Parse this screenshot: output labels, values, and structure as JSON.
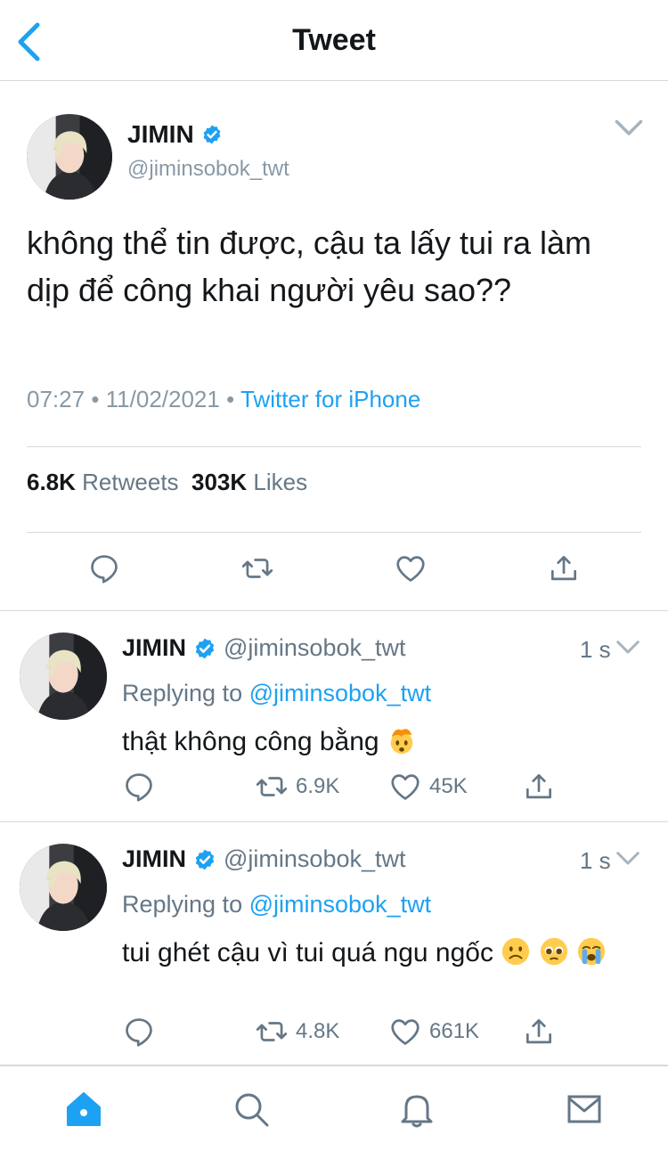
{
  "header": {
    "title": "Tweet"
  },
  "main_tweet": {
    "name": "JIMIN",
    "handle": "@jiminsobok_twt",
    "text": "không thể tin được, cậu ta lấy tui ra làm dịp để công khai người yêu sao??",
    "time": "07:27",
    "sep": "•",
    "date": "11/02/2021",
    "source": "Twitter for iPhone",
    "retweets_count": "6.8K",
    "retweets_label": "Retweets",
    "likes_count": "303K",
    "likes_label": "Likes"
  },
  "replies": [
    {
      "name": "JIMIN",
      "handle": "@jiminsobok_twt",
      "time": "1 s",
      "replying_label": "Replying to",
      "replying_to": "@jiminsobok_twt",
      "text": "thật không công bằng",
      "emojis": [
        "exploding-head-emoji"
      ],
      "retweets": "6.9K",
      "likes": "45K"
    },
    {
      "name": "JIMIN",
      "handle": "@jiminsobok_twt",
      "time": "1 s",
      "replying_label": "Replying to",
      "replying_to": "@jiminsobok_twt",
      "text": "tui ghét cậu vì tui quá ngu ngốc",
      "emojis": [
        "frowning-face-emoji",
        "pleading-face-emoji",
        "crying-face-emoji"
      ],
      "retweets": "4.8K",
      "likes": "661K"
    }
  ],
  "tabbar": {
    "items": [
      "home-icon",
      "search-icon",
      "bell-icon",
      "mail-icon"
    ]
  },
  "colors": {
    "accent": "#1da1f2",
    "muted": "#657786",
    "divider": "#d8d8d8",
    "verified": "#1da1f2"
  }
}
